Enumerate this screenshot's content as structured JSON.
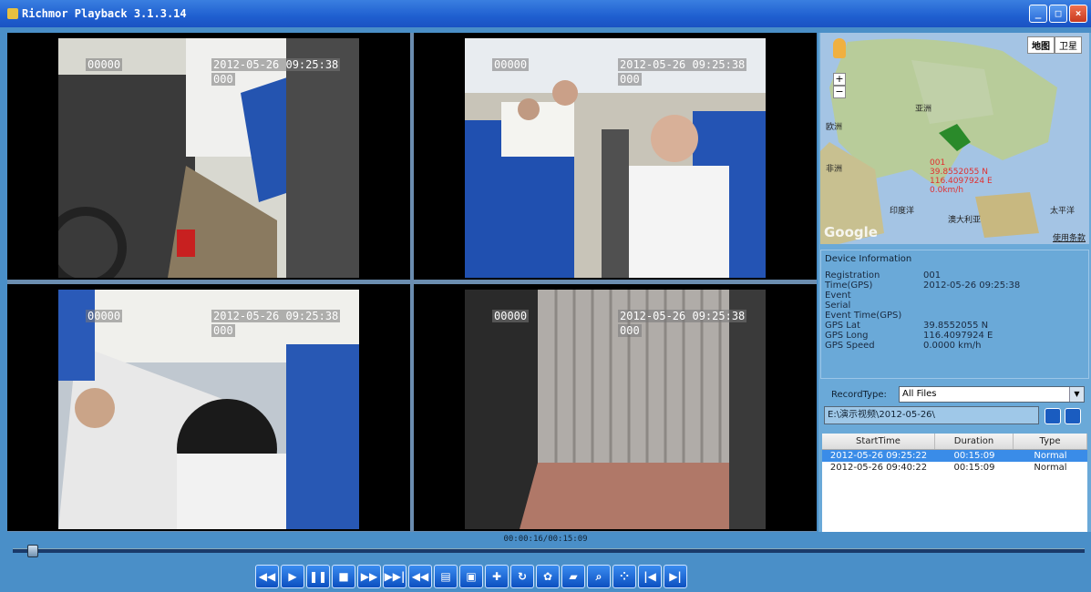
{
  "window": {
    "title": "Richmor Playback 3.1.3.14"
  },
  "cameras": [
    {
      "label": "00000",
      "timestamp": "2012-05-26 09:25:38",
      "sub": "000"
    },
    {
      "label": "00000",
      "timestamp": "2012-05-26 09:25:38",
      "sub": "000"
    },
    {
      "label": "00000",
      "timestamp": "2012-05-26 09:25:38",
      "sub": "000"
    },
    {
      "label": "00000",
      "timestamp": "2012-05-26 09:25:38",
      "sub": "000"
    }
  ],
  "map": {
    "tabs": [
      "地图",
      "卫星"
    ],
    "labels": [
      "亚洲",
      "欧洲",
      "非洲",
      "印度洋",
      "澳大利亚",
      "太平洋"
    ],
    "marker_info": [
      "001",
      "39.8552055 N",
      "116.4097924 E",
      "0.0km/h"
    ],
    "footer": "使用条款",
    "google": "Google"
  },
  "device_info": {
    "title": "Device Information",
    "rows": [
      {
        "k": "Registration",
        "v": "001"
      },
      {
        "k": "Time(GPS)",
        "v": "2012-05-26 09:25:38"
      },
      {
        "k": "Event",
        "v": ""
      },
      {
        "k": "Serial",
        "v": ""
      },
      {
        "k": "Event Time(GPS)",
        "v": ""
      },
      {
        "k": "GPS Lat",
        "v": "39.8552055 N"
      },
      {
        "k": "GPS Long",
        "v": "116.4097924 E"
      },
      {
        "k": "GPS Speed",
        "v": "0.0000 km/h"
      }
    ]
  },
  "record": {
    "type_label": "RecordType:",
    "type_value": "All Files",
    "path": "E:\\演示视频\\2012-05-26\\",
    "columns": [
      "StartTime",
      "Duration",
      "Type"
    ],
    "rows": [
      {
        "start": "2012-05-26 09:25:22",
        "duration": "00:15:09",
        "type": "Normal",
        "selected": true
      },
      {
        "start": "2012-05-26 09:40:22",
        "duration": "00:15:09",
        "type": "Normal",
        "selected": false
      }
    ]
  },
  "playback": {
    "timecode": "00:00:16/00:15:09",
    "progress": 0.014,
    "buttons": [
      "rewind",
      "play",
      "pause",
      "stop",
      "fast-forward",
      "step-forward",
      "step-back",
      "snapshot",
      "export",
      "add",
      "refresh",
      "settings",
      "open",
      "zoom",
      "layout",
      "first",
      "last"
    ]
  }
}
